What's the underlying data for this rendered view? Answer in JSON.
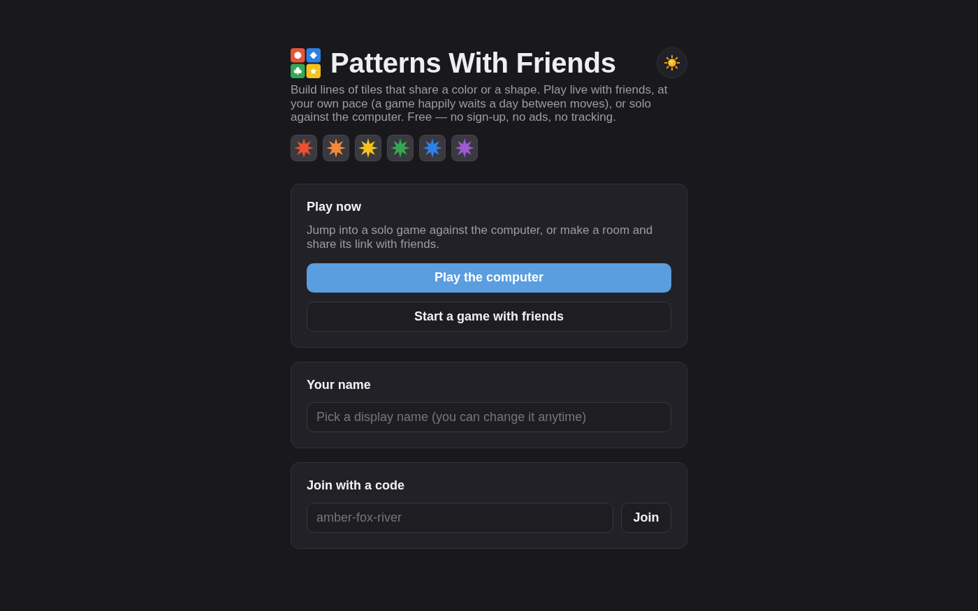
{
  "header": {
    "title": "Patterns With Friends"
  },
  "description": "Build lines of tiles that share a color or a shape. Play live with friends, at your own pace (a game happily waits a day between moves), or solo against the computer. Free — no sign-up, no ads, no tracking.",
  "tile_colors": [
    {
      "color": "#e8522f"
    },
    {
      "color": "#f08a3c"
    },
    {
      "color": "#f4c21b"
    },
    {
      "color": "#35a552"
    },
    {
      "color": "#2f80e6"
    },
    {
      "color": "#9b5bd2"
    }
  ],
  "play_card": {
    "title": "Play now",
    "description": "Jump into a solo game against the computer, or make a room and share its link with friends.",
    "buttons": [
      {
        "label": "Play the computer",
        "kind": "primary"
      },
      {
        "label": "Start a game with friends",
        "kind": "secondary"
      }
    ]
  },
  "name_card": {
    "title": "Your name",
    "input": {
      "placeholder": "Pick a display name (you can change it anytime)"
    }
  },
  "join_card": {
    "title": "Join with a code",
    "input": {
      "placeholder": "amber-fox-river"
    },
    "button": "Join"
  }
}
